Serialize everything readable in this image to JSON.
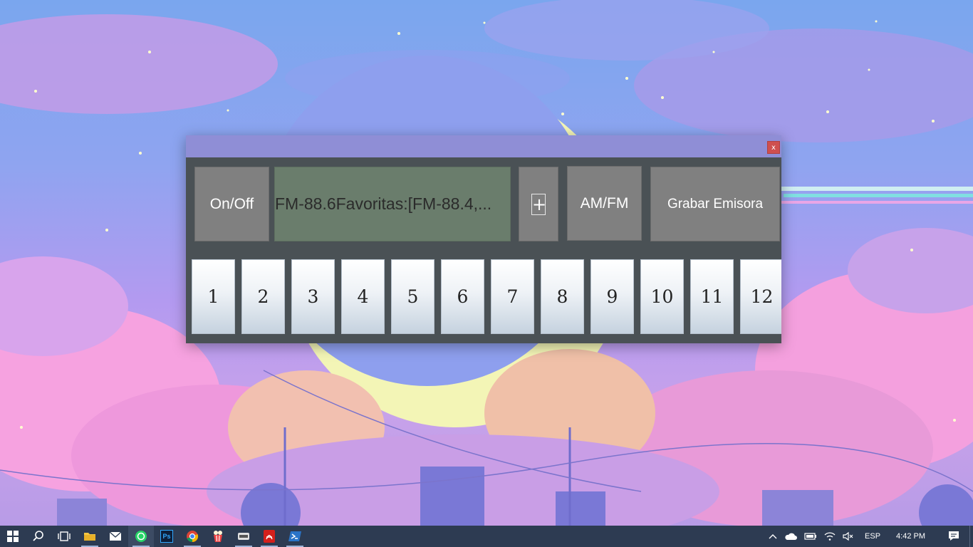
{
  "window": {
    "close_label": "x",
    "onoff_label": "On/Off",
    "display_text": "FM-88.6Favoritas:[FM-88.4,...",
    "plus_label": "+",
    "amfm_label": "AM/FM",
    "record_label": "Grabar Emisora",
    "presets": [
      "1",
      "2",
      "3",
      "4",
      "5",
      "6",
      "7",
      "8",
      "9",
      "10",
      "11",
      "12"
    ]
  },
  "taskbar": {
    "apps": [
      "start-icon",
      "search-icon",
      "task-view-icon",
      "file-explorer-icon",
      "mail-icon",
      "whatsapp-icon",
      "photoshop-icon",
      "chrome-icon",
      "popcorn-icon",
      "app-icon",
      "acrobat-icon",
      "powershell-icon"
    ],
    "ps_label": "Ps",
    "language": "ESP",
    "time": "4:42 PM"
  },
  "colors": {
    "titlebar": "#8f8ed6",
    "window_body": "#4a5155",
    "button": "#808080",
    "display": "#6a7d6c",
    "close": "#cf4f4f",
    "taskbar": "#2d3b52"
  }
}
